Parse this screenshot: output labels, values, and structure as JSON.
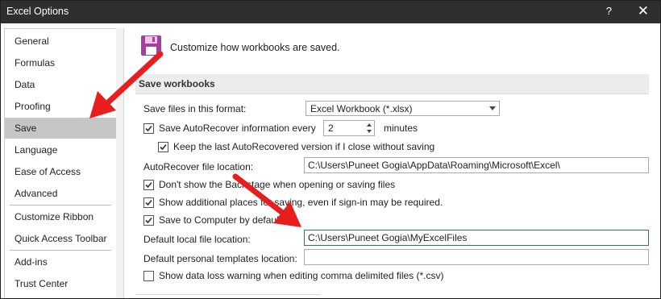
{
  "titlebar": {
    "title": "Excel Options",
    "help": "?",
    "close": "✕"
  },
  "sidebar": {
    "items": [
      {
        "label": "General"
      },
      {
        "label": "Formulas"
      },
      {
        "label": "Data"
      },
      {
        "label": "Proofing"
      },
      {
        "label": "Save",
        "selected": true
      },
      {
        "label": "Language"
      },
      {
        "label": "Ease of Access"
      },
      {
        "label": "Advanced"
      },
      {
        "label": "Customize Ribbon"
      },
      {
        "label": "Quick Access Toolbar"
      },
      {
        "label": "Add-ins"
      },
      {
        "label": "Trust Center"
      }
    ]
  },
  "main": {
    "heading": "Customize how workbooks are saved.",
    "section_title": "Save workbooks",
    "format_label": "Save files in this format:",
    "format_value": "Excel Workbook (*.xlsx)",
    "autorecover": {
      "label": "Save AutoRecover information every",
      "checked": true,
      "value": "2",
      "unit": "minutes"
    },
    "keep_last": {
      "label": "Keep the last AutoRecovered version if I close without saving",
      "checked": true
    },
    "autorecover_location": {
      "label": "AutoRecover file location:",
      "value": "C:\\Users\\Puneet Gogia\\AppData\\Roaming\\Microsoft\\Excel\\"
    },
    "backstage": {
      "label": "Don't show the Backstage when opening or saving files",
      "checked": true
    },
    "additional_places": {
      "label": "Show additional places for saving, even if sign-in may be required.",
      "checked": true
    },
    "save_to_computer": {
      "label": "Save to Computer by default",
      "checked": true
    },
    "default_location": {
      "label": "Default local file location:",
      "value": "C:\\Users\\Puneet Gogia\\MyExcelFiles"
    },
    "templates_location": {
      "label": "Default personal templates location:",
      "value": ""
    },
    "csv_warning": {
      "label": "Show data loss warning when editing comma delimited files (*.csv)",
      "checked": false
    }
  },
  "colors": {
    "titlebar": "#2f2f2f",
    "selected_nav": "#c6c6c6",
    "arrow": "#e81e1e",
    "disk": "#a43f9e"
  }
}
